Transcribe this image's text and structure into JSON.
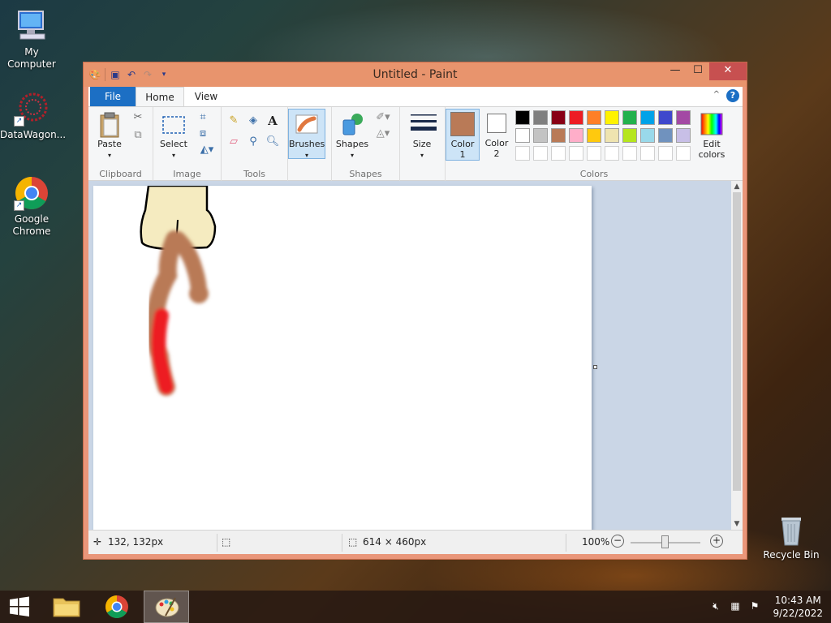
{
  "desktop": {
    "icons": [
      {
        "label": "My Computer"
      },
      {
        "label": "DataWagon..."
      },
      {
        "label": "Google Chrome"
      },
      {
        "label": "Recycle Bin"
      }
    ]
  },
  "window": {
    "title": "Untitled - Paint",
    "controls": {
      "minimize": "—",
      "maximize": "☐",
      "close": "✕"
    }
  },
  "tabs": {
    "file": "File",
    "home": "Home",
    "view": "View",
    "help": "?"
  },
  "ribbon": {
    "clipboard": {
      "paste": "Paste",
      "label": "Clipboard"
    },
    "image": {
      "select": "Select",
      "label": "Image"
    },
    "tools": {
      "label": "Tools",
      "text_tool": "A"
    },
    "brushes": {
      "label": "Brushes"
    },
    "shapes": {
      "shapes_button": "Shapes",
      "label": "Shapes"
    },
    "size": {
      "label": "Size"
    },
    "colors": {
      "color1": "Color",
      "color1_num": "1",
      "color2": "Color",
      "color2_num": "2",
      "edit": "Edit",
      "edit2": "colors",
      "label": "Colors",
      "color1_value": "#b97a57",
      "color2_value": "#ffffff",
      "palette_row1": [
        "#000000",
        "#7f7f7f",
        "#880015",
        "#ed1c24",
        "#ff7f27",
        "#fff200",
        "#22b14c",
        "#00a2e8",
        "#3f48cc",
        "#a349a4"
      ],
      "palette_row2": [
        "#ffffff",
        "#c3c3c3",
        "#b97a57",
        "#ffaec9",
        "#ffc90e",
        "#efe4b0",
        "#b5e61d",
        "#99d9ea",
        "#7092be",
        "#c8bfe7"
      ],
      "palette_row3": [
        "#ffffff",
        "#ffffff",
        "#ffffff",
        "#ffffff",
        "#ffffff",
        "#ffffff",
        "#ffffff",
        "#ffffff",
        "#ffffff",
        "#ffffff"
      ]
    }
  },
  "status": {
    "cursor_pos": "132, 132px",
    "canvas_size": "614 × 460px",
    "zoom": "100%"
  },
  "taskbar": {
    "time": "10:43 AM",
    "date": "9/22/2022"
  }
}
